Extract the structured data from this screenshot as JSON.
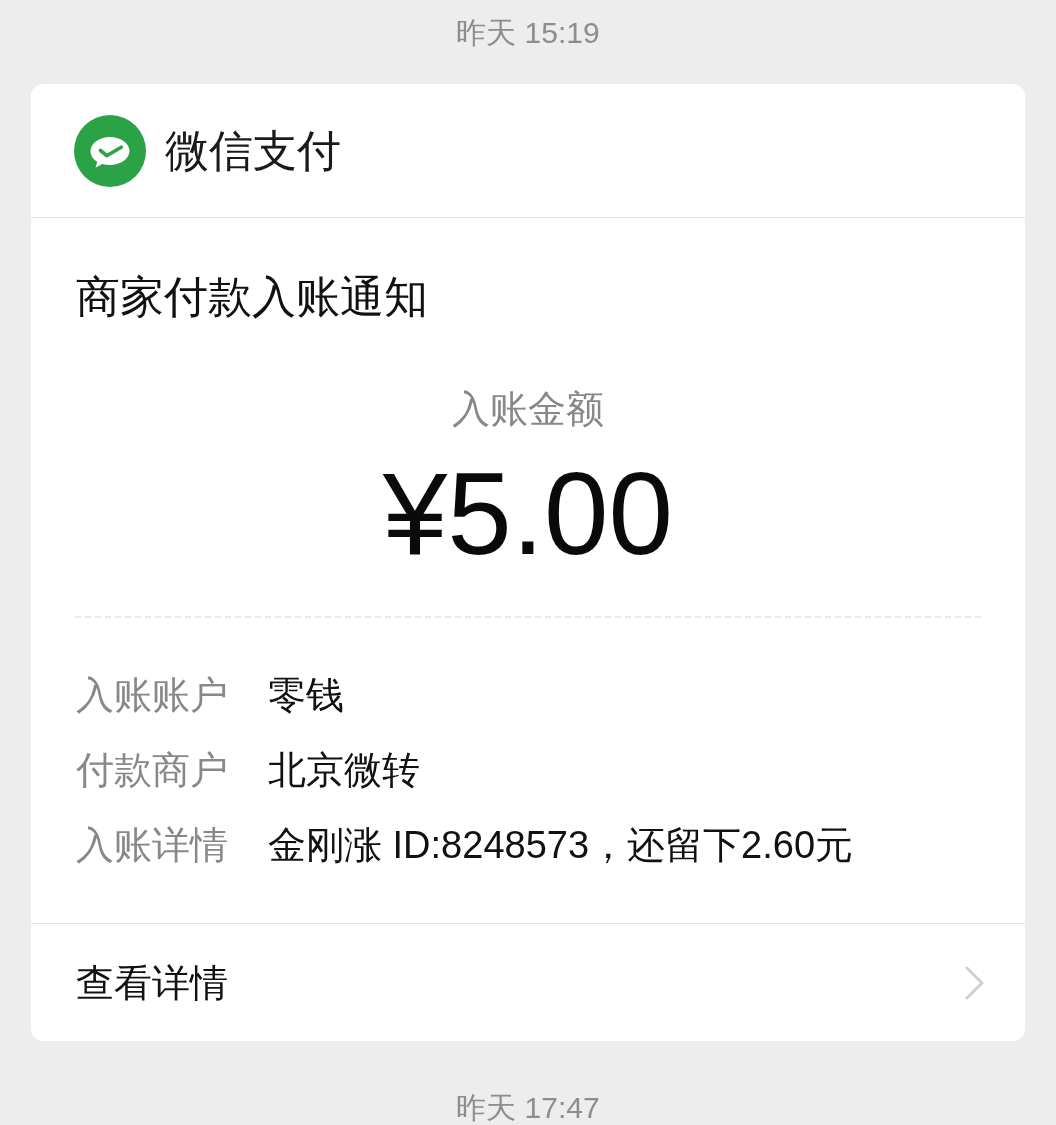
{
  "timestamp_top": "昨天 15:19",
  "card": {
    "app_name": "微信支付",
    "title": "商家付款入账通知",
    "amount_label": "入账金额",
    "amount": "¥5.00",
    "details": [
      {
        "label": "入账账户",
        "value": "零钱"
      },
      {
        "label": "付款商户",
        "value": "北京微转"
      },
      {
        "label": "入账详情",
        "value": "金刚涨 ID:8248573，还留下2.60元"
      }
    ],
    "link": "查看详情"
  },
  "timestamp_bottom": "昨天 17:47"
}
